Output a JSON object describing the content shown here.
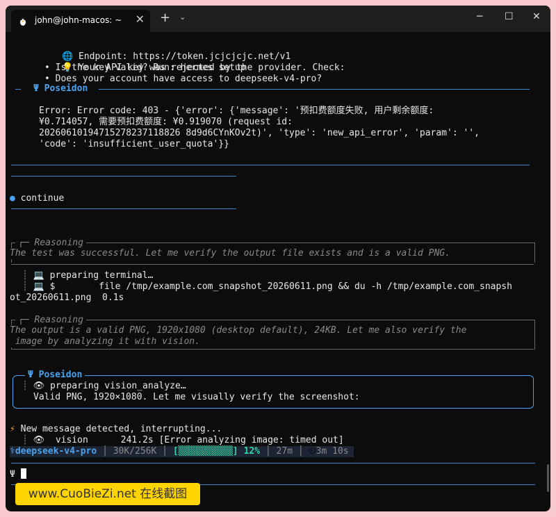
{
  "window": {
    "tab_title": "john@john-macos: ~",
    "tab_close": "✕",
    "new_tab": "+",
    "dropdown": "⌄",
    "minimize": "─",
    "maximize": "☐",
    "close": "✕"
  },
  "terminal": {
    "endpoint": "Endpoint: https://token.jcjcjcjc.net/v1",
    "api_rejected": "Your API key was rejected by the provider. Check:",
    "bullet_valid": "• Is the key valid? Run: hermes setup",
    "bullet_access": "• Does your account have access to deepseek-v4-pro?",
    "poseidon_header": "Ψ Poseidon",
    "error_line1": "Error: Error code: 403 - {'error': {'message': '预扣费额度失败, 用户剩余额度:",
    "error_line2": "¥0.714057, 需要预扣费额度: ¥0.919070 (request id:",
    "error_line3": "20260610194715278237118826 8d9d6CYnKOv2t)', 'type': 'new_api_error', 'param': '',",
    "error_line4": "'code': 'insufficient_user_quota'}}",
    "continue_bullet": "●",
    "continue_text": "continue",
    "reasoning1_header": "Reasoning",
    "reasoning1_text": "The test was successful. Let me verify the output file exists and is a valid PNG.",
    "preparing_terminal": "preparing terminal…",
    "cmd_prompt": "$",
    "cmd_line": "file /tmp/example.com_snapshot_20260611.png && du -h /tmp/example.com_snapsh",
    "cmd_wrap": "ot_20260611.png  0.1s",
    "reasoning2_header": "Reasoning",
    "reasoning2_line1": "The output is a valid PNG, 1920x1080 (desktop default), 24KB. Let me also verify the",
    "reasoning2_line2": " image by analyzing it with vision.",
    "poseidon2_header": "Ψ Poseidon",
    "preparing_vision": "preparing vision_analyze…",
    "valid_png": "Valid PNG, 1920×1080. Let me visually verify the screenshot:",
    "new_message": "New message detected, interrupting...",
    "vision_label": "vision",
    "vision_time": "241.2s",
    "vision_error": "[Error analyzing image: timed out]",
    "prompt_symbol": "Ψ"
  },
  "status_bar": {
    "model": "deepseek-v4-pro",
    "tokens": "30K/256K",
    "progress_bar": "[▒▒▒▒▒▒▒▒▒▒]",
    "percent": "12%",
    "duration": "27m",
    "timer": "3m 10s",
    "progress_fraction": 0.12
  },
  "watermark": "www.CuoBieZi.net 在线截图",
  "colors": {
    "accent": "#4aa3f0",
    "background": "#0c0c0c",
    "warning": "#f59a2c",
    "progress": "#2fd6a8"
  }
}
